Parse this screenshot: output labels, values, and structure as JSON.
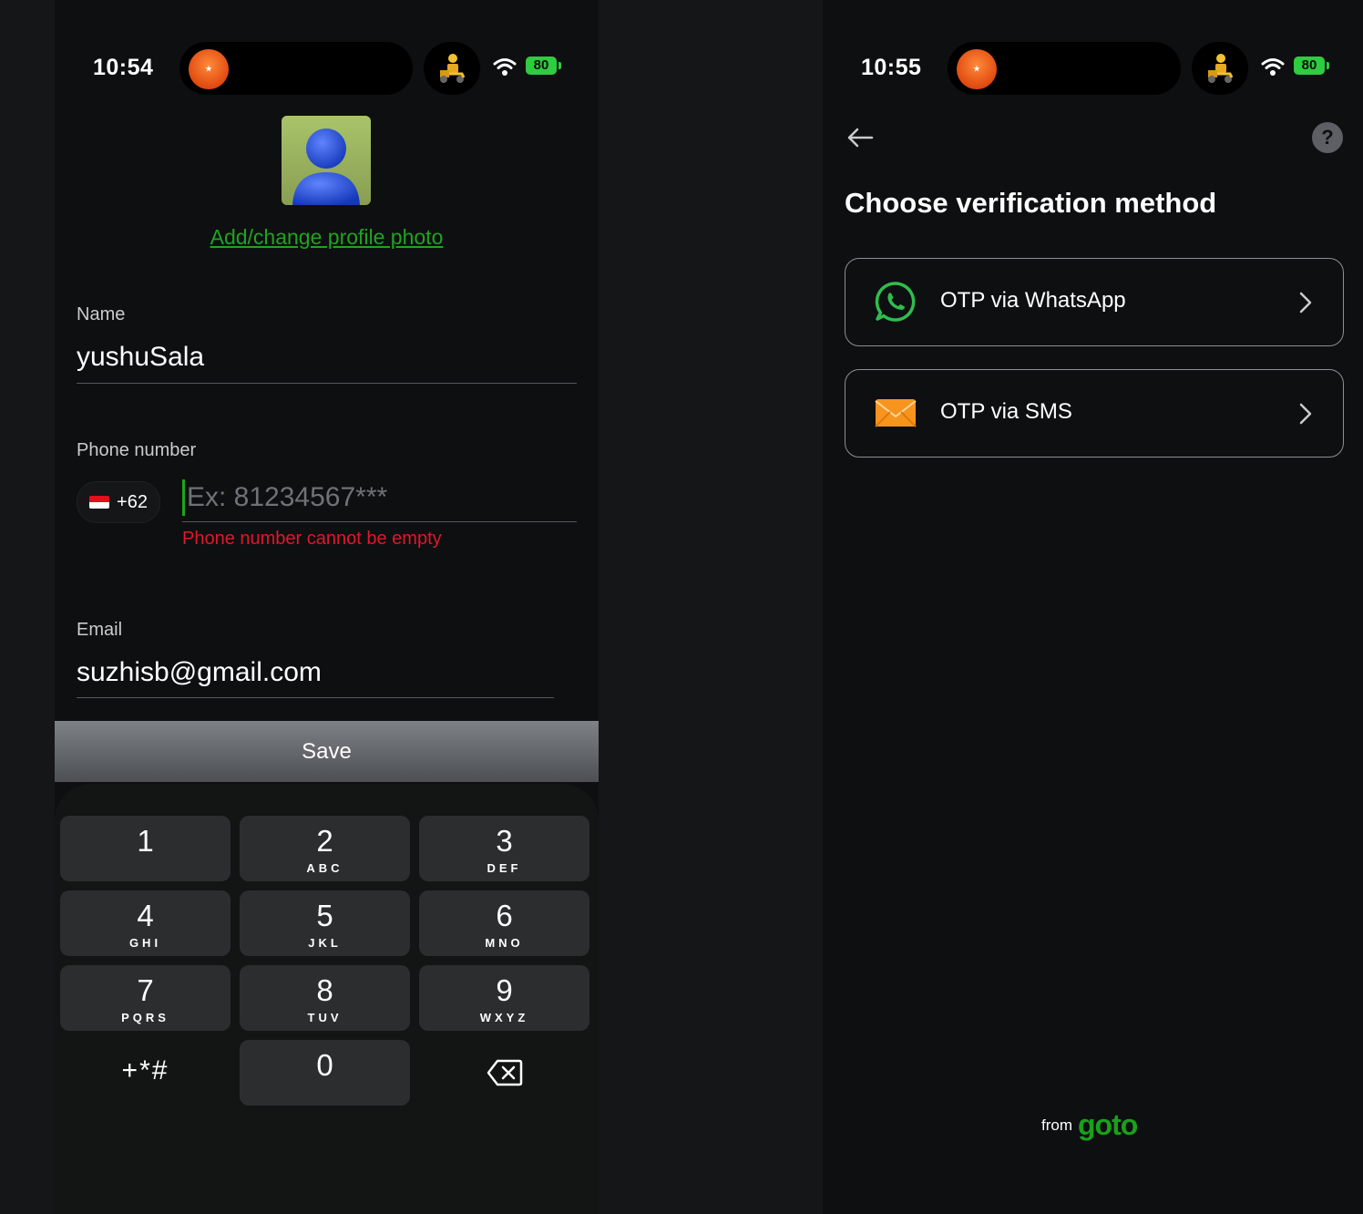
{
  "left_screen": {
    "status": {
      "time": "10:54",
      "battery": "80"
    },
    "profile": {
      "photo_link": "Add/change profile photo"
    },
    "name": {
      "label": "Name",
      "value": "yushuSala"
    },
    "phone": {
      "label": "Phone number",
      "country_code": "+62",
      "placeholder": "Ex: 81234567***",
      "error": "Phone number cannot be empty"
    },
    "email": {
      "label": "Email",
      "value": "suzhisb@gmail.com"
    },
    "save_label": "Save",
    "keypad": {
      "k1": {
        "num": "1",
        "sub": ""
      },
      "k2": {
        "num": "2",
        "sub": "ABC"
      },
      "k3": {
        "num": "3",
        "sub": "DEF"
      },
      "k4": {
        "num": "4",
        "sub": "GHI"
      },
      "k5": {
        "num": "5",
        "sub": "JKL"
      },
      "k6": {
        "num": "6",
        "sub": "MNO"
      },
      "k7": {
        "num": "7",
        "sub": "PQRS"
      },
      "k8": {
        "num": "8",
        "sub": "TUV"
      },
      "k9": {
        "num": "9",
        "sub": "WXYZ"
      },
      "symbols": "+*#",
      "k0": {
        "num": "0"
      },
      "backspace_icon": "backspace-icon"
    }
  },
  "right_screen": {
    "status": {
      "time": "10:55",
      "battery": "80"
    },
    "heading": "Choose verification method",
    "options": [
      {
        "label": "OTP via WhatsApp",
        "icon": "whatsapp-icon"
      },
      {
        "label": "OTP via SMS",
        "icon": "envelope-icon"
      }
    ],
    "footer": {
      "from": "from",
      "brand": "goto"
    }
  },
  "colors": {
    "accent_green": "#1ea51e",
    "error_red": "#e3162a",
    "background": "#0e0f10"
  }
}
